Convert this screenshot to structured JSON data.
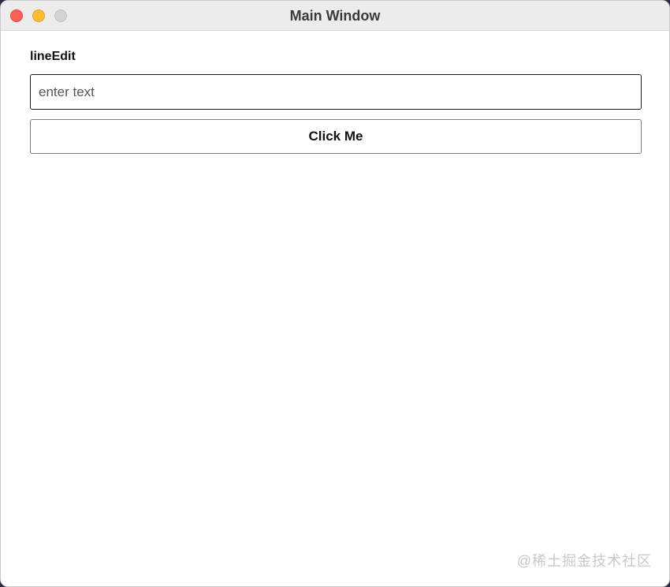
{
  "window": {
    "title": "Main Window"
  },
  "form": {
    "label": "lineEdit",
    "input_placeholder": "enter text",
    "input_value": "",
    "button_label": "Click Me"
  },
  "watermark": {
    "text": "@稀土掘金技术社区"
  }
}
